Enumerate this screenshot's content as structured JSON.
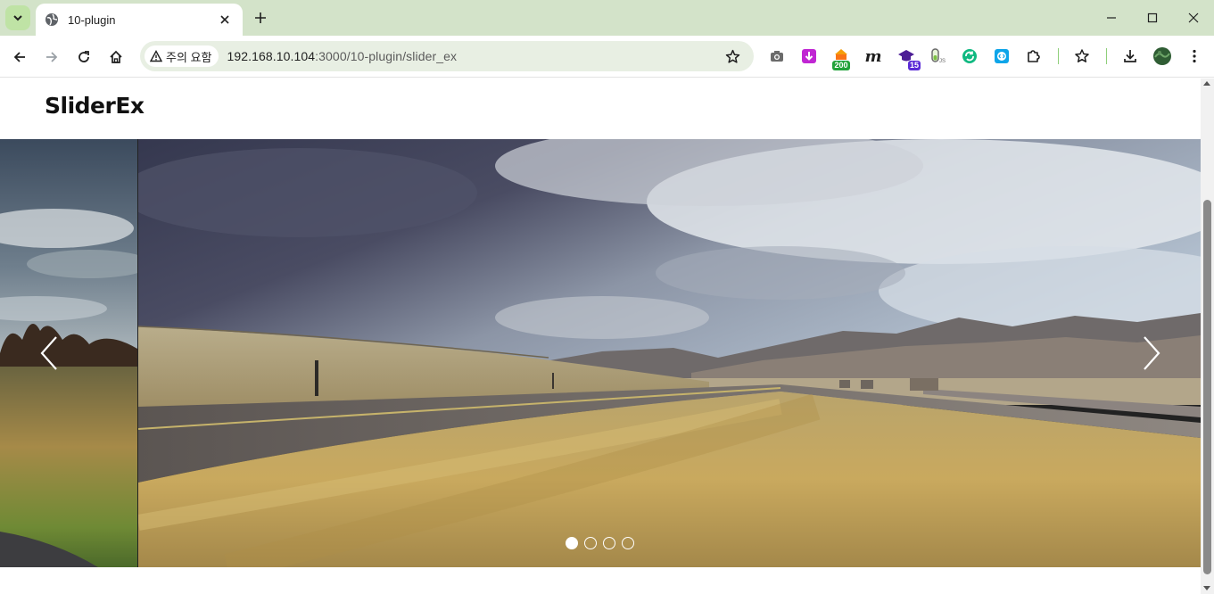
{
  "browser": {
    "tab": {
      "title": "10-plugin"
    },
    "omnibox": {
      "security_label": "주의 요함",
      "url_host": "192.168.10.104",
      "url_path": ":3000/10-plugin/slider_ex"
    },
    "extensions": [
      {
        "name": "screenshot-icon"
      },
      {
        "name": "download-ext-icon",
        "color": "#c026d3"
      },
      {
        "name": "counter-ext-icon",
        "badge": "200",
        "badge_color": "#22a33a"
      },
      {
        "name": "m-ext-icon",
        "glyph": "m"
      },
      {
        "name": "grad-cap-ext-icon",
        "badge": "15",
        "badge_color": "#5b2bd6"
      },
      {
        "name": "js-ext-icon"
      },
      {
        "name": "sync-ext-icon",
        "color": "#10b981"
      },
      {
        "name": "code-ext-icon",
        "color": "#0ea5e9"
      }
    ]
  },
  "page": {
    "title": "SliderEx"
  },
  "slider": {
    "slide_count": 4,
    "active_index": 0
  },
  "colors": {
    "tabstrip": "#d3e3c9",
    "omnibox": "#e8efe3"
  }
}
